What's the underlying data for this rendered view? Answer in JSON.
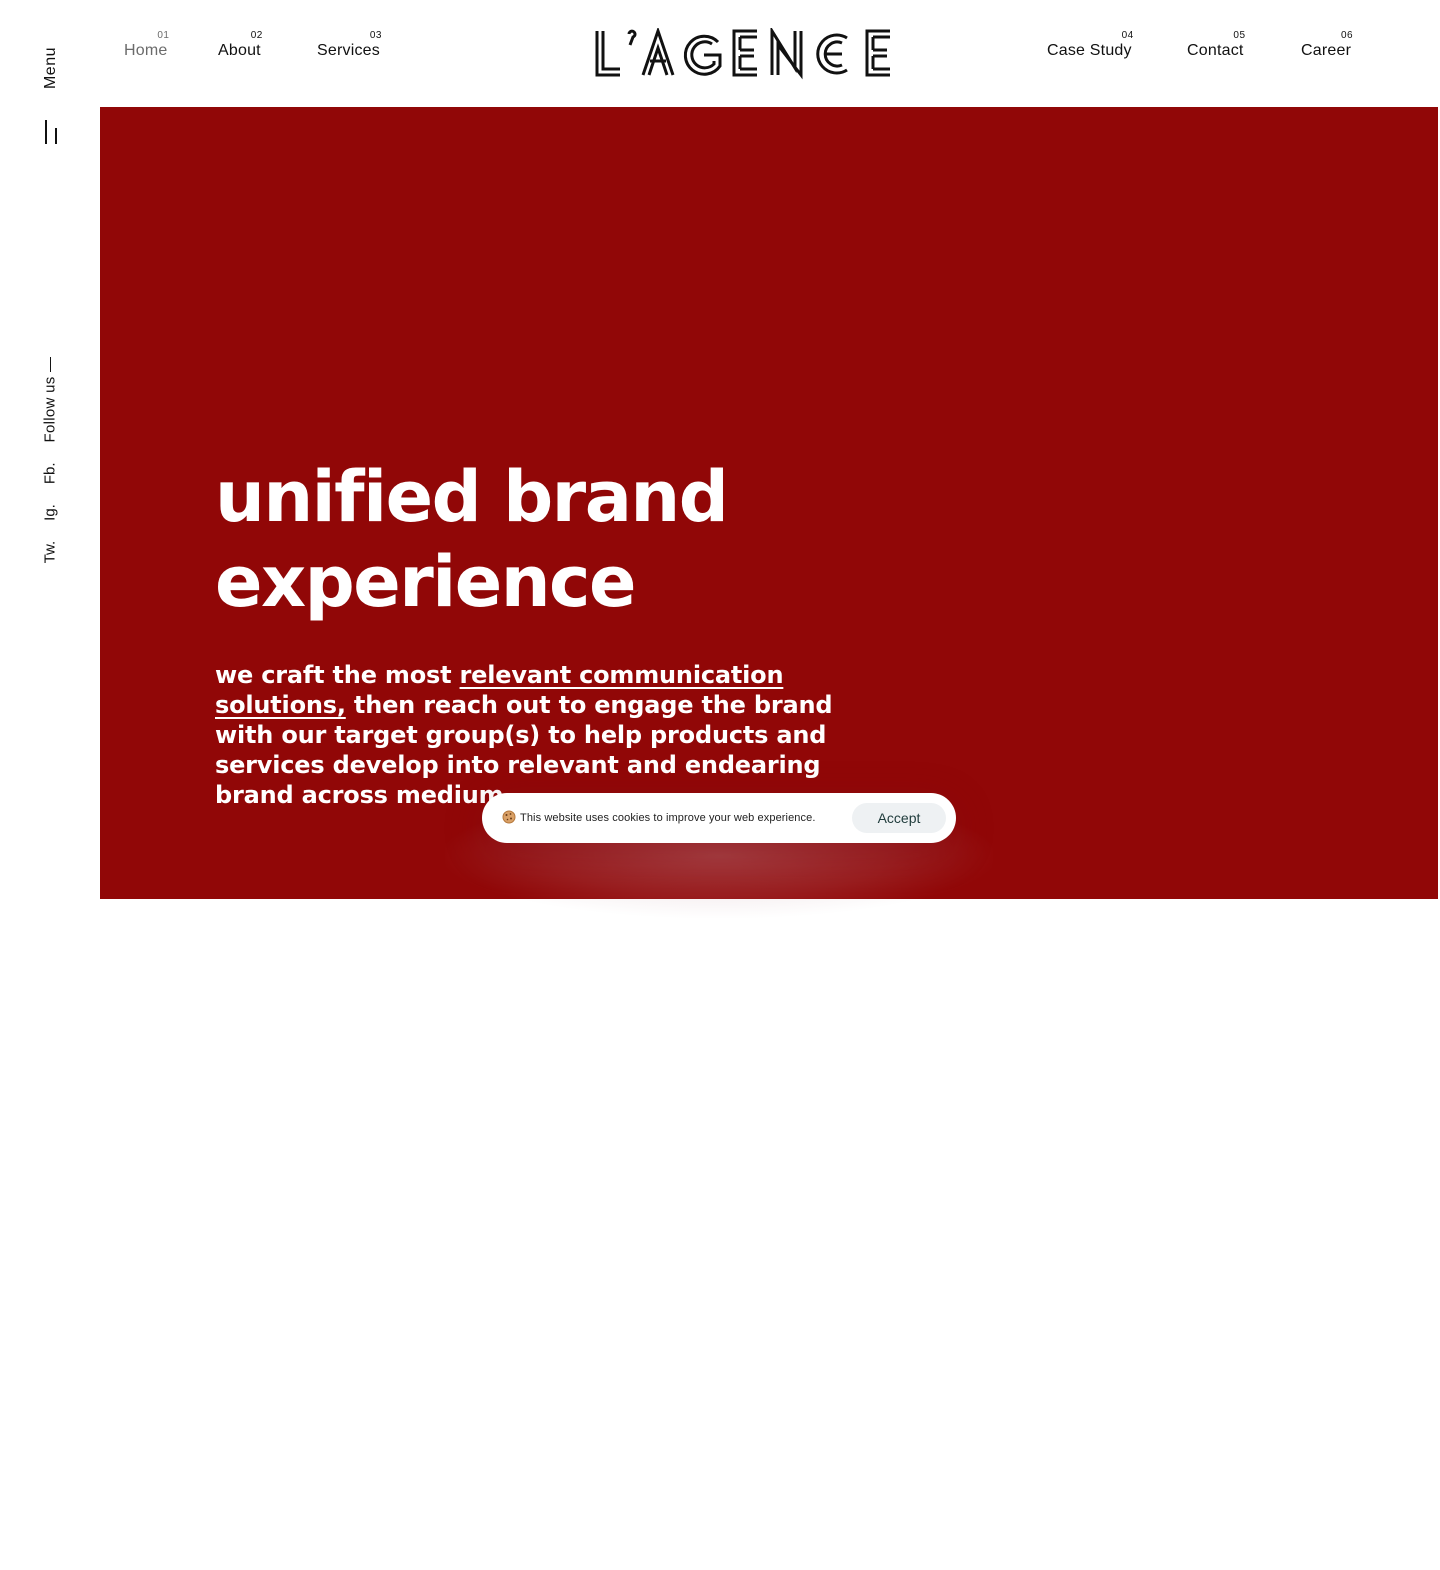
{
  "sidebar": {
    "menu_label": "Menu",
    "follow_label": "Follow us —",
    "social": [
      "Fb.",
      "Ig.",
      "Tw."
    ]
  },
  "nav": {
    "left": [
      {
        "num": "01",
        "label": "Home",
        "active": true
      },
      {
        "num": "02",
        "label": "About"
      },
      {
        "num": "03",
        "label": "Services"
      }
    ],
    "right": [
      {
        "num": "04",
        "label": "Case Study"
      },
      {
        "num": "05",
        "label": "Contact"
      },
      {
        "num": "06",
        "label": "Career"
      }
    ]
  },
  "logo": {
    "text": "L’AGENCE"
  },
  "hero": {
    "title": "unified brand experience",
    "desc_prefix": "we craft the most ",
    "desc_highlight": "relevant communication solutions,",
    "desc_suffix": " then reach out to engage the brand with our target group(s) to help products and services develop into relevant and endearing brand across medium",
    "background": "#910707"
  },
  "cookie": {
    "icon": "cookie-icon",
    "text": "This website uses cookies to improve your web experience.",
    "accept_label": "Accept"
  }
}
